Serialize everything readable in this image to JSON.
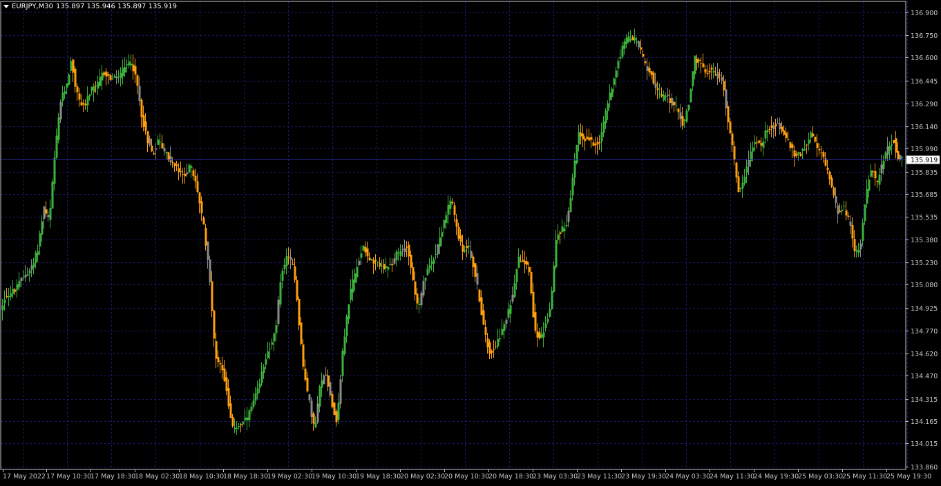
{
  "header": {
    "symbol": "EURJPY,M30",
    "ohlc": "135.897 135.946 135.897 135.919"
  },
  "colors": {
    "background": "#000000",
    "grid": "#1a1a6e",
    "axis": "#c8c8c8",
    "bull": "#3cb43c",
    "bear": "#ff9f10",
    "neutral": "#8c8c8c",
    "price_line": "#2a2aa0"
  },
  "chart_data": {
    "type": "candlestick",
    "symbol": "EURJPY",
    "timeframe": "M30",
    "ylim": [
      133.86,
      136.92
    ],
    "grid": true,
    "current_price": "135.919",
    "y_ticks": [
      "136.900",
      "136.750",
      "136.600",
      "136.445",
      "136.290",
      "136.140",
      "135.990",
      "135.835",
      "135.685",
      "135.535",
      "135.380",
      "135.230",
      "135.080",
      "134.925",
      "134.770",
      "134.620",
      "134.470",
      "134.315",
      "134.165",
      "134.015",
      "133.860"
    ],
    "x_ticks": [
      "17 May 2022",
      "17 May 10:30",
      "17 May 18:30",
      "18 May 02:30",
      "18 May 10:30",
      "18 May 18:30",
      "19 May 02:30",
      "19 May 10:30",
      "19 May 18:30",
      "20 May 02:30",
      "20 May 10:30",
      "20 May 18:30",
      "23 May 03:30",
      "23 May 11:30",
      "23 May 19:30",
      "24 May 03:30",
      "24 May 11:30",
      "24 May 19:30",
      "25 May 03:30",
      "25 May 11:30",
      "25 May 19:30"
    ],
    "price_path": [
      [
        0,
        134.88
      ],
      [
        8,
        135.0
      ],
      [
        16,
        135.02
      ],
      [
        24,
        135.05
      ],
      [
        32,
        135.12
      ],
      [
        40,
        135.16
      ],
      [
        48,
        135.2
      ],
      [
        56,
        135.33
      ],
      [
        64,
        135.6
      ],
      [
        72,
        135.5
      ],
      [
        80,
        135.95
      ],
      [
        88,
        136.3
      ],
      [
        96,
        136.4
      ],
      [
        104,
        136.58
      ],
      [
        110,
        136.4
      ],
      [
        116,
        136.3
      ],
      [
        124,
        136.28
      ],
      [
        132,
        136.38
      ],
      [
        140,
        136.4
      ],
      [
        150,
        136.5
      ],
      [
        160,
        136.46
      ],
      [
        170,
        136.46
      ],
      [
        180,
        136.52
      ],
      [
        190,
        136.58
      ],
      [
        198,
        136.45
      ],
      [
        206,
        136.2
      ],
      [
        214,
        136.05
      ],
      [
        222,
        135.95
      ],
      [
        230,
        136.05
      ],
      [
        238,
        135.98
      ],
      [
        248,
        135.9
      ],
      [
        258,
        135.85
      ],
      [
        266,
        135.8
      ],
      [
        276,
        135.88
      ],
      [
        286,
        135.72
      ],
      [
        296,
        135.45
      ],
      [
        304,
        135.15
      ],
      [
        312,
        134.6
      ],
      [
        320,
        134.55
      ],
      [
        328,
        134.4
      ],
      [
        336,
        134.12
      ],
      [
        344,
        134.13
      ],
      [
        352,
        134.15
      ],
      [
        360,
        134.2
      ],
      [
        368,
        134.3
      ],
      [
        376,
        134.4
      ],
      [
        384,
        134.58
      ],
      [
        392,
        134.67
      ],
      [
        400,
        134.77
      ],
      [
        406,
        135.1
      ],
      [
        414,
        135.25
      ],
      [
        420,
        135.25
      ],
      [
        426,
        135.2
      ],
      [
        432,
        134.9
      ],
      [
        440,
        134.5
      ],
      [
        448,
        134.3
      ],
      [
        456,
        134.1
      ],
      [
        464,
        134.4
      ],
      [
        472,
        134.5
      ],
      [
        480,
        134.3
      ],
      [
        488,
        134.15
      ],
      [
        496,
        134.6
      ],
      [
        504,
        134.92
      ],
      [
        510,
        135.08
      ],
      [
        518,
        135.2
      ],
      [
        526,
        135.35
      ],
      [
        534,
        135.26
      ],
      [
        542,
        135.22
      ],
      [
        550,
        135.22
      ],
      [
        558,
        135.18
      ],
      [
        566,
        135.2
      ],
      [
        574,
        135.28
      ],
      [
        582,
        135.3
      ],
      [
        590,
        135.35
      ],
      [
        598,
        135.12
      ],
      [
        606,
        134.9
      ],
      [
        614,
        135.1
      ],
      [
        622,
        135.2
      ],
      [
        630,
        135.28
      ],
      [
        638,
        135.4
      ],
      [
        646,
        135.55
      ],
      [
        654,
        135.65
      ],
      [
        662,
        135.45
      ],
      [
        670,
        135.3
      ],
      [
        678,
        135.35
      ],
      [
        686,
        135.2
      ],
      [
        694,
        135.0
      ],
      [
        702,
        134.75
      ],
      [
        710,
        134.62
      ],
      [
        718,
        134.68
      ],
      [
        726,
        134.75
      ],
      [
        734,
        134.85
      ],
      [
        742,
        135.0
      ],
      [
        750,
        135.25
      ],
      [
        758,
        135.25
      ],
      [
        766,
        135.2
      ],
      [
        774,
        134.8
      ],
      [
        782,
        134.7
      ],
      [
        790,
        134.8
      ],
      [
        798,
        134.95
      ],
      [
        806,
        135.4
      ],
      [
        814,
        135.45
      ],
      [
        822,
        135.5
      ],
      [
        830,
        135.8
      ],
      [
        838,
        136.1
      ],
      [
        846,
        136.05
      ],
      [
        854,
        136.05
      ],
      [
        862,
        136.02
      ],
      [
        870,
        136.05
      ],
      [
        878,
        136.25
      ],
      [
        886,
        136.4
      ],
      [
        894,
        136.55
      ],
      [
        902,
        136.68
      ],
      [
        910,
        136.73
      ],
      [
        918,
        136.72
      ],
      [
        926,
        136.68
      ],
      [
        934,
        136.55
      ],
      [
        942,
        136.5
      ],
      [
        950,
        136.4
      ],
      [
        958,
        136.32
      ],
      [
        966,
        136.35
      ],
      [
        974,
        136.28
      ],
      [
        982,
        136.25
      ],
      [
        990,
        136.14
      ],
      [
        998,
        136.3
      ],
      [
        1006,
        136.6
      ],
      [
        1014,
        136.55
      ],
      [
        1022,
        136.5
      ],
      [
        1030,
        136.52
      ],
      [
        1038,
        136.48
      ],
      [
        1046,
        136.45
      ],
      [
        1054,
        136.2
      ],
      [
        1062,
        135.95
      ],
      [
        1070,
        135.7
      ],
      [
        1078,
        135.8
      ],
      [
        1086,
        135.95
      ],
      [
        1094,
        136.05
      ],
      [
        1102,
        136.0
      ],
      [
        1110,
        136.12
      ],
      [
        1118,
        136.14
      ],
      [
        1126,
        136.15
      ],
      [
        1134,
        136.1
      ],
      [
        1142,
        136.03
      ],
      [
        1150,
        135.95
      ],
      [
        1158,
        135.95
      ],
      [
        1166,
        136.0
      ],
      [
        1174,
        136.1
      ],
      [
        1182,
        136.0
      ],
      [
        1190,
        135.95
      ],
      [
        1198,
        135.85
      ],
      [
        1206,
        135.72
      ],
      [
        1214,
        135.55
      ],
      [
        1222,
        135.6
      ],
      [
        1230,
        135.5
      ],
      [
        1238,
        135.28
      ],
      [
        1246,
        135.35
      ],
      [
        1254,
        135.7
      ],
      [
        1262,
        135.85
      ],
      [
        1270,
        135.75
      ],
      [
        1278,
        135.9
      ],
      [
        1286,
        136.0
      ],
      [
        1294,
        136.05
      ],
      [
        1300,
        135.93
      ],
      [
        1306,
        135.919
      ]
    ]
  }
}
